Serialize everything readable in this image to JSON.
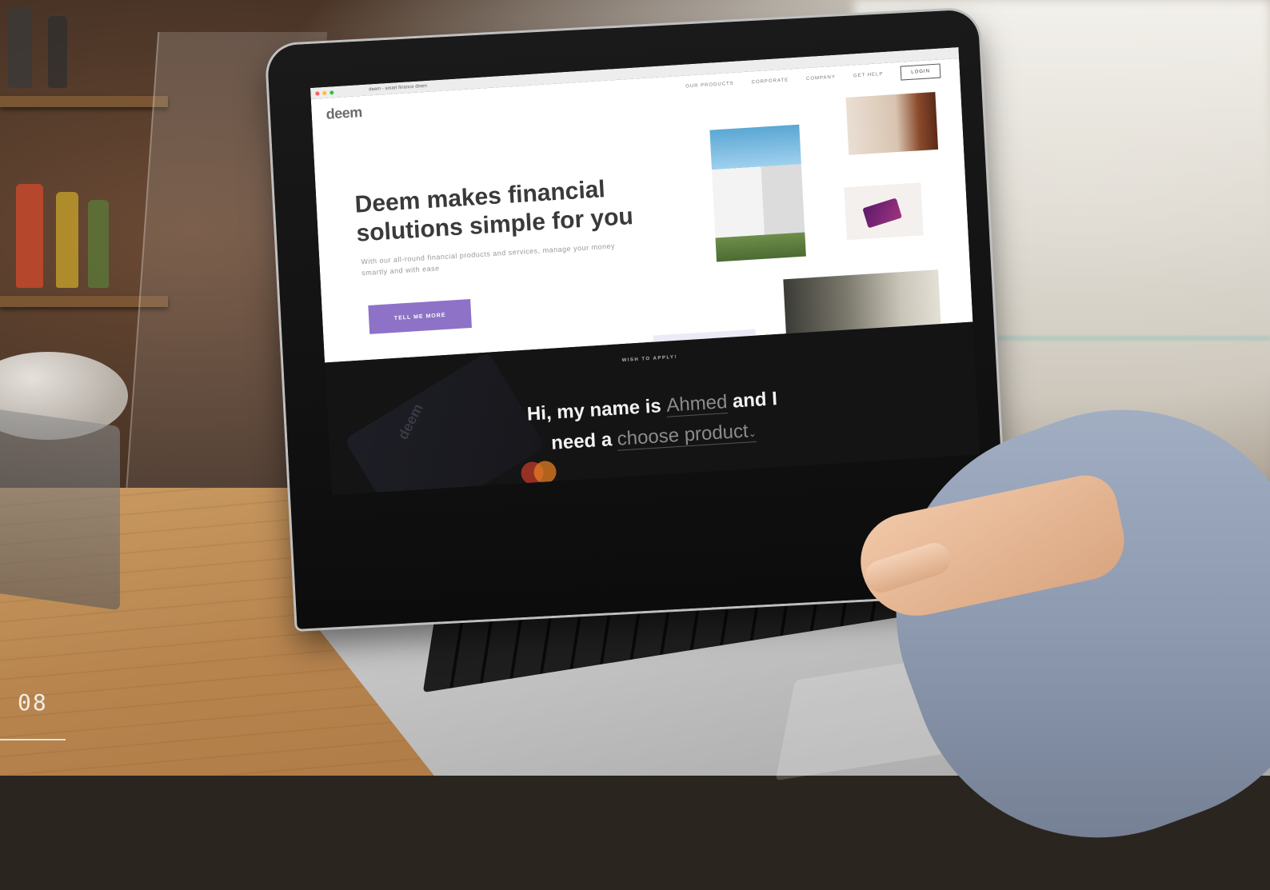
{
  "browser": {
    "tab_title": "deem - smart finance deem"
  },
  "header": {
    "logo": "deem",
    "nav": [
      {
        "label": "OUR PRODUCTS"
      },
      {
        "label": "CORPORATE"
      },
      {
        "label": "COMPANY"
      },
      {
        "label": "GET HELP"
      }
    ],
    "login_label": "LOGIN"
  },
  "hero": {
    "headline": "Deem makes financial solutions simple for you",
    "subtext": "With our all-round financial products and services, manage your money smartly and with ease",
    "cta_label": "TELL ME MORE"
  },
  "apply": {
    "label": "WISH TO APPLY!",
    "line1_prefix": "Hi, my name is",
    "name_value": "Ahmed",
    "line1_suffix": "and I",
    "line2_prefix": "need a",
    "product_placeholder": "choose product",
    "chevron": "⌄"
  },
  "decor": {
    "ghost_logo": "deem"
  },
  "page": {
    "number": "08"
  },
  "colors": {
    "accent": "#8d72c7",
    "dark_section": "#141414"
  }
}
